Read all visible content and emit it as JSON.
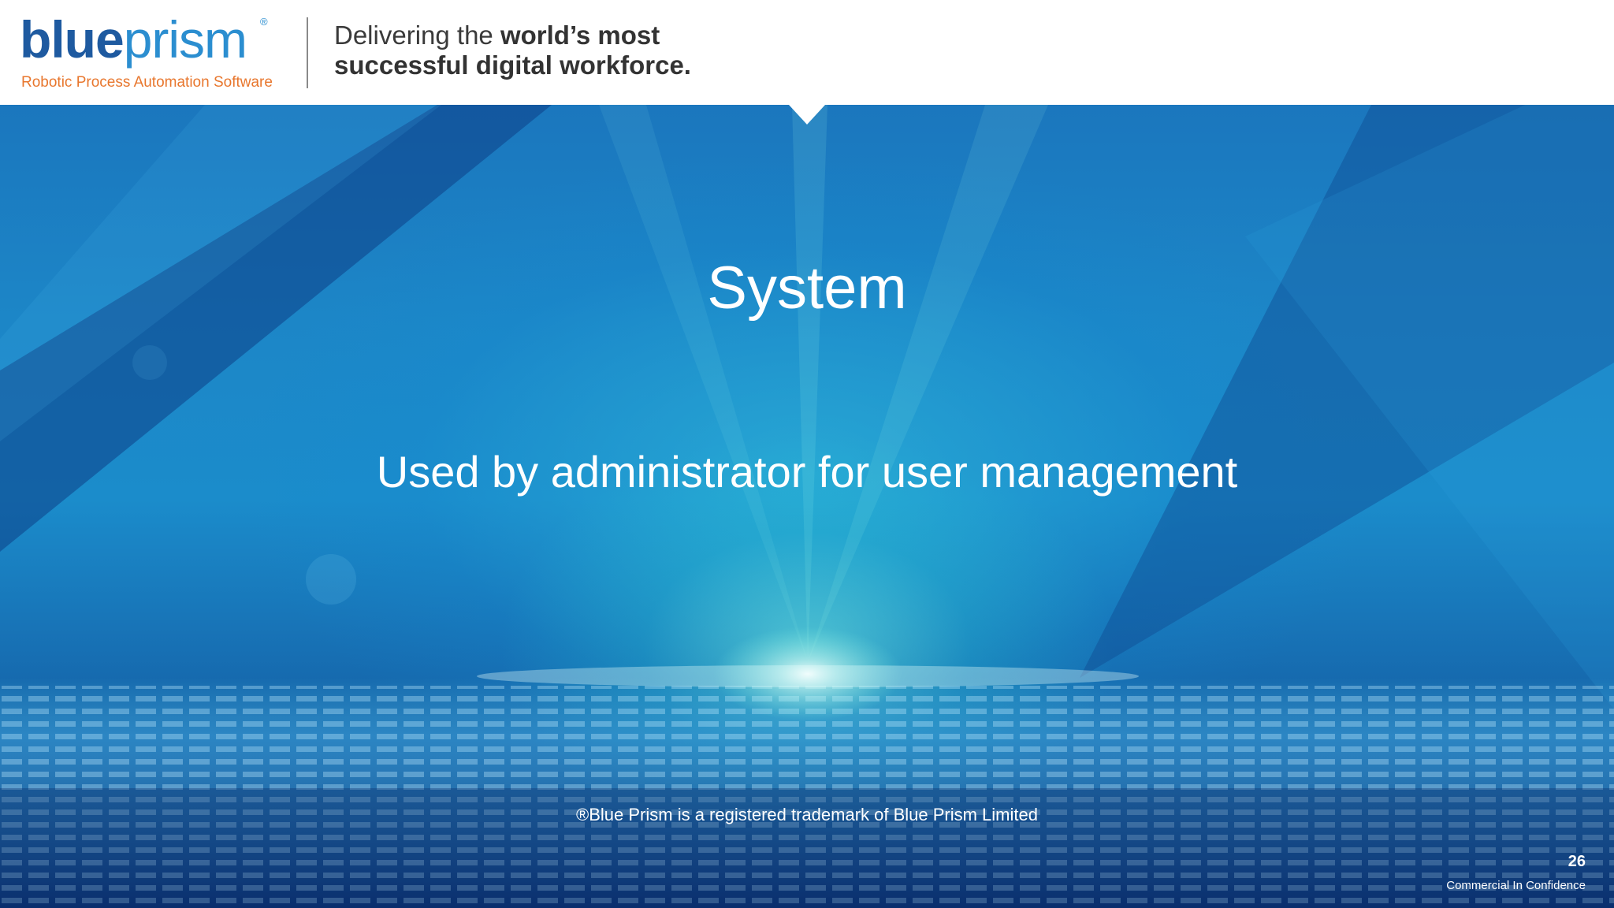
{
  "header": {
    "logo": {
      "word_bold": "blue",
      "word_light": "prism",
      "registered_mark": "®",
      "tagline": "Robotic Process Automation Software"
    },
    "tagline": {
      "line1_regular": "Delivering the ",
      "line1_bold": "world’s most",
      "line2_bold": "successful digital workforce."
    }
  },
  "slide": {
    "title": "System",
    "subtitle": "Used by administrator for user management",
    "trademark": "®Blue Prism is a registered trademark of Blue Prism Limited",
    "page_number": "26",
    "confidentiality": "Commercial In Confidence"
  },
  "colors": {
    "logo_blue": "#1e5aa0",
    "logo_light_blue": "#2b8ed0",
    "logo_orange": "#e8772e",
    "header_text": "#3a3a3a",
    "background_blue": "#1b8ccb",
    "text_white": "#ffffff"
  }
}
